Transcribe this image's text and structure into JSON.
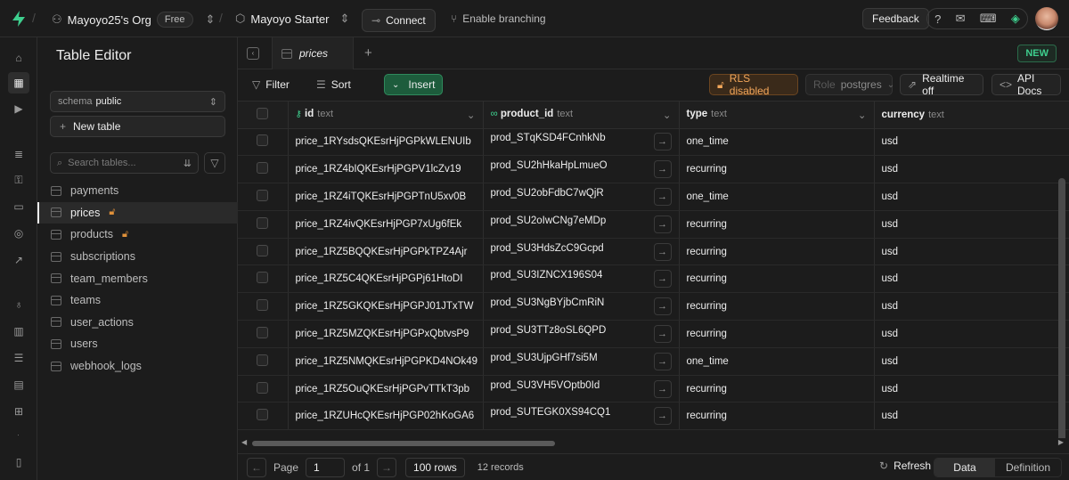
{
  "topbar": {
    "org": "Mayoyo25's Org",
    "plan": "Free",
    "project": "Mayoyo Starter",
    "connect": "Connect",
    "branching": "Enable branching",
    "feedback": "Feedback"
  },
  "sidebar": {
    "title": "Table Editor",
    "schema_label": "schema",
    "schema_value": "public",
    "new_table": "New table",
    "search_placeholder": "Search tables...",
    "tables": [
      {
        "name": "payments",
        "locked": false,
        "active": false
      },
      {
        "name": "prices",
        "locked": true,
        "active": true
      },
      {
        "name": "products",
        "locked": true,
        "active": false
      },
      {
        "name": "subscriptions",
        "locked": false,
        "active": false
      },
      {
        "name": "team_members",
        "locked": false,
        "active": false
      },
      {
        "name": "teams",
        "locked": false,
        "active": false
      },
      {
        "name": "user_actions",
        "locked": false,
        "active": false
      },
      {
        "name": "users",
        "locked": false,
        "active": false
      },
      {
        "name": "webhook_logs",
        "locked": false,
        "active": false
      }
    ]
  },
  "tab": {
    "label": "prices",
    "new_badge": "NEW"
  },
  "toolbar": {
    "filter": "Filter",
    "sort": "Sort",
    "insert": "Insert",
    "rls": "RLS disabled",
    "role_label": "Role",
    "role_value": "postgres",
    "realtime": "Realtime off",
    "api_docs": "API Docs"
  },
  "columns": [
    {
      "name": "id",
      "type": "text"
    },
    {
      "name": "product_id",
      "type": "text"
    },
    {
      "name": "type",
      "type": "text"
    },
    {
      "name": "currency",
      "type": "text"
    }
  ],
  "rows": [
    [
      "price_1RYsdsQKEsrHjPGPkWLENUIb",
      "prod_STqKSD4FCnhkNb",
      "one_time",
      "usd"
    ],
    [
      "price_1RZ4bIQKEsrHjPGPV1lcZv19",
      "prod_SU2hHkaHpLmueO",
      "recurring",
      "usd"
    ],
    [
      "price_1RZ4iTQKEsrHjPGPTnU5xv0B",
      "prod_SU2obFdbC7wQjR",
      "one_time",
      "usd"
    ],
    [
      "price_1RZ4ivQKEsrHjPGP7xUg6fEk",
      "prod_SU2oIwCNg7eMDp",
      "recurring",
      "usd"
    ],
    [
      "price_1RZ5BQQKEsrHjPGPkTPZ4Ajr",
      "prod_SU3HdsZcC9Gcpd",
      "recurring",
      "usd"
    ],
    [
      "price_1RZ5C4QKEsrHjPGPj61HtoDI",
      "prod_SU3IZNCX196S04",
      "recurring",
      "usd"
    ],
    [
      "price_1RZ5GKQKEsrHjPGPJ01JTxTW",
      "prod_SU3NgBYjbCmRiN",
      "recurring",
      "usd"
    ],
    [
      "price_1RZ5MZQKEsrHjPGPxQbtvsP9",
      "prod_SU3TTz8oSL6QPD",
      "recurring",
      "usd"
    ],
    [
      "price_1RZ5NMQKEsrHjPGPKD4NOk49",
      "prod_SU3UjpGHf7si5M",
      "one_time",
      "usd"
    ],
    [
      "price_1RZ5OuQKEsrHjPGPvTTkT3pb",
      "prod_SU3VH5VOptb0Id",
      "recurring",
      "usd"
    ],
    [
      "price_1RZUHcQKEsrHjPGP02hKoGA6",
      "prod_SUTEGK0XS94CQ1",
      "recurring",
      "usd"
    ]
  ],
  "footer": {
    "page_label": "Page",
    "page_value": "1",
    "of": "of 1",
    "rows": "100 rows",
    "records": "12 records",
    "refresh": "Refresh",
    "data": "Data",
    "definition": "Definition"
  }
}
